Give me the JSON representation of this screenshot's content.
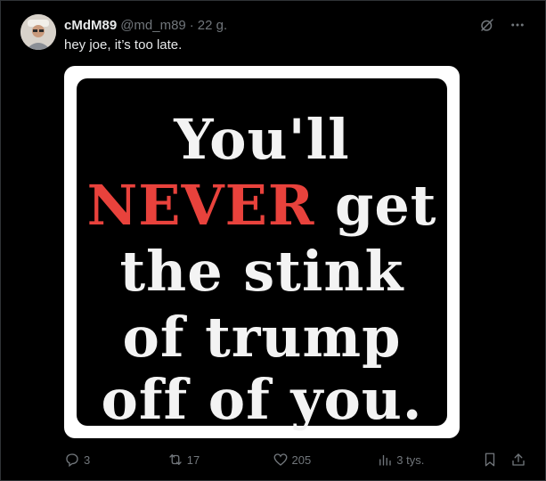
{
  "tweet": {
    "display_name": "cMdM89",
    "handle": "@md_m89",
    "separator": "·",
    "time": "22 g.",
    "text": "hey joe, it’s too late."
  },
  "poster": {
    "line1": "You'll",
    "line2_red": "NEVER",
    "line2_rest": "get",
    "line3": "the stink",
    "line4": "of trump",
    "line5": "off of you."
  },
  "actions": {
    "replies": "3",
    "reposts": "17",
    "likes": "205",
    "views": "3 tys."
  },
  "icons": {
    "grok": "grok-icon",
    "more": "more-icon",
    "reply": "reply-icon",
    "repost": "repost-icon",
    "like": "heart-icon",
    "views": "views-icon",
    "bookmark": "bookmark-icon",
    "share": "share-icon"
  },
  "colors": {
    "background": "#000000",
    "text": "#e7e9ea",
    "muted": "#71767b",
    "poster_red": "#e8423c"
  }
}
